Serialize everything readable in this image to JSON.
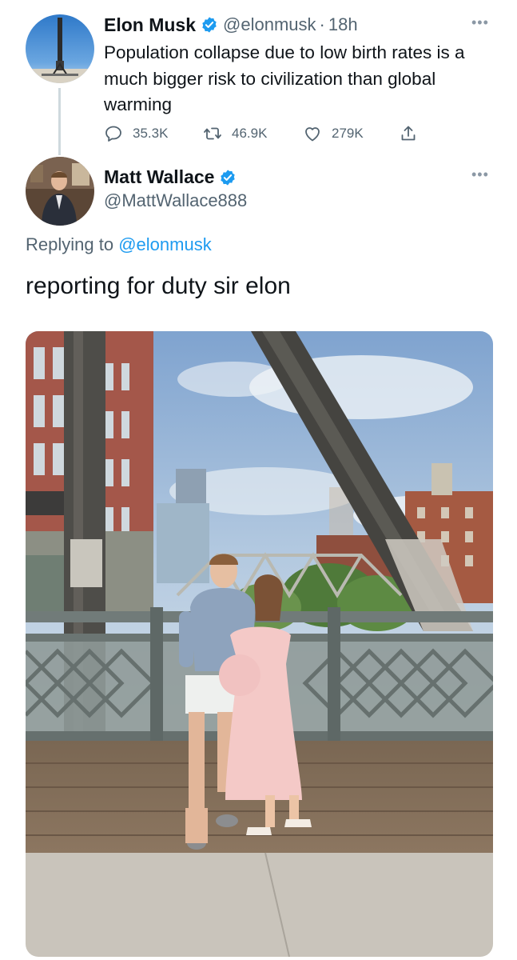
{
  "tweet": {
    "author_name": "Elon Musk",
    "author_handle": "@elonmusk",
    "separator": "·",
    "time": "18h",
    "text": "Population collapse due to low birth rates is a much bigger risk to civilization than global warming",
    "more_icon": "more-icon",
    "stats": {
      "replies": "35.3K",
      "retweets": "46.9K",
      "likes": "279K"
    }
  },
  "reply": {
    "author_name": "Matt Wallace",
    "author_handle": "@MattWallace888",
    "replying_prefix": "Replying to",
    "replying_to": "@elonmusk",
    "text": "reporting for duty sir elon"
  },
  "colors": {
    "text": "#0f1419",
    "secondary": "#536471",
    "accent": "#1d9bf0",
    "thread_line": "#cfd9de"
  },
  "icons": [
    "verified-badge-icon",
    "reply-icon",
    "retweet-icon",
    "like-icon",
    "share-icon",
    "more-icon"
  ]
}
